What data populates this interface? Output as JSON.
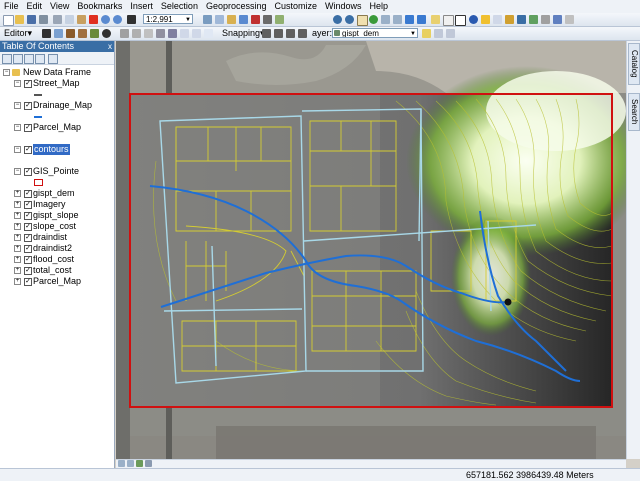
{
  "menu": [
    "File",
    "Edit",
    "View",
    "Bookmarks",
    "Insert",
    "Selection",
    "Geoprocessing",
    "Customize",
    "Windows",
    "Help"
  ],
  "toolbar": {
    "scale": "1:2,991",
    "editor_label": "Editor▾",
    "snapping_label": "Snapping▾",
    "layer_label": "ayer:",
    "layer_value": "gispt_dem"
  },
  "toc": {
    "title": "Table Of Contents",
    "close": "x",
    "frame": "New Data Frame",
    "layers": [
      {
        "name": "Street_Map",
        "checked": true,
        "expanded": true,
        "symbol": "line",
        "symbol_color": "#555555"
      },
      {
        "name": "Drainage_Map",
        "checked": true,
        "expanded": true,
        "symbol": "line",
        "symbol_color": "#1f6fd6"
      },
      {
        "name": "Parcel_Map",
        "checked": true,
        "expanded": true,
        "symbol": "none"
      },
      {
        "name": "contours",
        "checked": true,
        "expanded": true,
        "symbol": "none",
        "highlight": true
      },
      {
        "name": "GIS_Pointe",
        "checked": true,
        "expanded": true,
        "symbol": "box",
        "symbol_color": "#d01010"
      },
      {
        "name": "gispt_dem",
        "checked": true,
        "expanded": false
      },
      {
        "name": "Imagery",
        "checked": true,
        "expanded": false
      },
      {
        "name": "gispt_slope",
        "checked": true,
        "expanded": false
      },
      {
        "name": "slope_cost",
        "checked": true,
        "expanded": false
      },
      {
        "name": "draindist",
        "checked": true,
        "expanded": false
      },
      {
        "name": "draindist2",
        "checked": true,
        "expanded": false
      },
      {
        "name": "flood_cost",
        "checked": true,
        "expanded": false
      },
      {
        "name": "total_cost",
        "checked": true,
        "expanded": false
      },
      {
        "name": "Parcel_Map",
        "checked": true,
        "expanded": false
      }
    ]
  },
  "side_tabs": [
    "Catalog",
    "Search"
  ],
  "status": {
    "coordinates": "657181.562  3986439.48 Meters"
  },
  "colors": {
    "contour": "#c8c830",
    "drainage": "#1f6fd6",
    "street": "#a8d8e8",
    "extent": "#d01010",
    "highlight": "#316ac5"
  }
}
